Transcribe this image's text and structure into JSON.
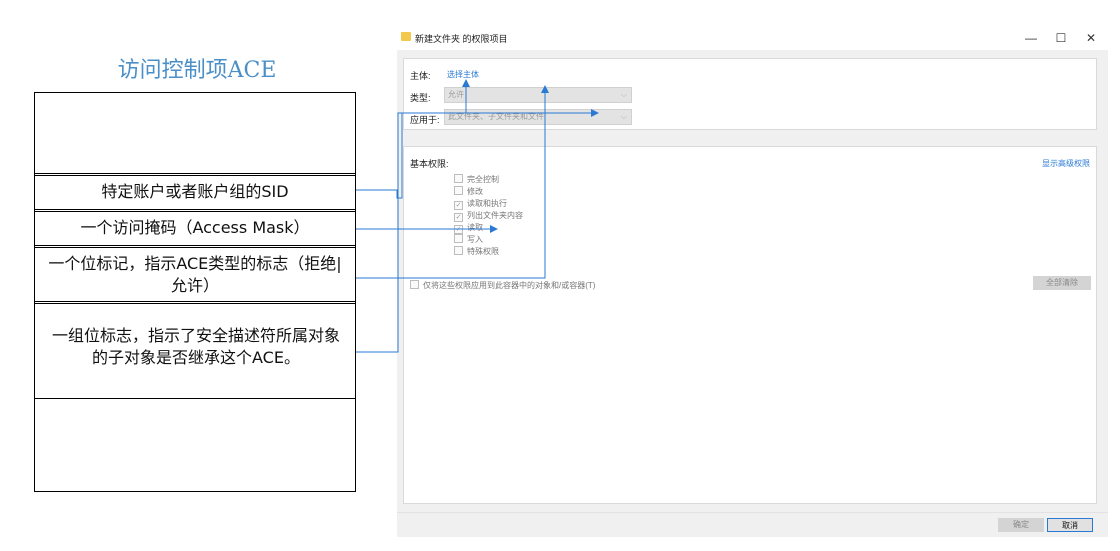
{
  "diagram": {
    "title": "访问控制项ACE",
    "rows": [
      {
        "text": ""
      },
      {
        "text": "特定账户或者账户组的SID"
      },
      {
        "text": "一个访问掩码（Access Mask）"
      },
      {
        "text": "一个位标记，指示ACE类型的标志（拒绝| 允许）"
      },
      {
        "text": "一组位标志，指示了安全描述符所属对象的子对象是否继承这个ACE。"
      },
      {
        "text": ""
      }
    ],
    "accent_color": "#4a8fc8",
    "connector_color": "#2a7ad5"
  },
  "dialog": {
    "title": "新建文件夹 的权限项目",
    "window_buttons": {
      "minimize": "—",
      "maximize": "☐",
      "close": "✕"
    },
    "principal_label": "主体:",
    "principal_link": "选择主体",
    "type_label": "类型:",
    "type_value": "允许",
    "applies_label": "应用于:",
    "applies_value": "此文件夹、子文件夹和文件",
    "basic_perms_label": "基本权限:",
    "advanced_link": "显示高级权限",
    "permissions": [
      {
        "label": "完全控制",
        "checked": false
      },
      {
        "label": "修改",
        "checked": false
      },
      {
        "label": "读取和执行",
        "checked": true
      },
      {
        "label": "列出文件夹内容",
        "checked": true
      },
      {
        "label": "读取",
        "checked": true
      },
      {
        "label": "写入",
        "checked": false
      },
      {
        "label": "特殊权限",
        "checked": false
      }
    ],
    "only_apply_label": "仅将这些权限应用到此容器中的对象和/或容器(T)",
    "clear_all": "全部清除",
    "ok": "确定",
    "cancel": "取消"
  }
}
